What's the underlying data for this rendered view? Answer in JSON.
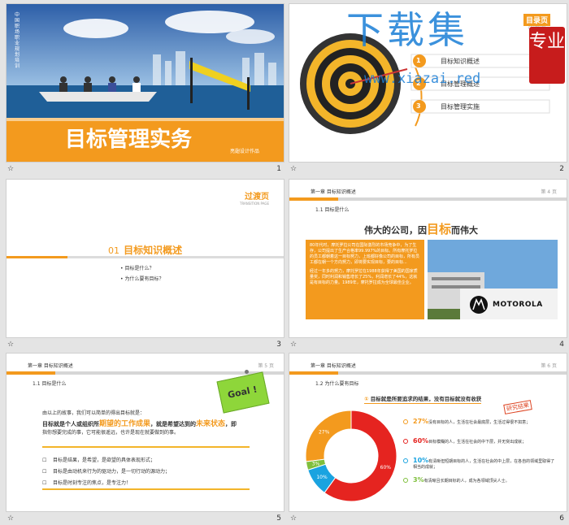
{
  "slides": {
    "s1": {
      "title": "目标管理实务",
      "vertical": "中国职场职业规划培训",
      "tag": "亮翅设计作品",
      "num": "1"
    },
    "s2": {
      "tag": "目录页",
      "tag_sub": "CONTENTS",
      "items": [
        {
          "n": "1",
          "label": "目标知识概述"
        },
        {
          "n": "2",
          "label": "目标管理概述"
        },
        {
          "n": "3",
          "label": "目标管理实施"
        }
      ],
      "num": "2",
      "watermark": "下载集",
      "watermark_url": "www.xiazai.red",
      "badge": "专业"
    },
    "s3": {
      "tag": "过渡页",
      "tag_sub": "TRANSITION PAGE",
      "sec_num": "01",
      "sec_title": "目标知识概述",
      "bullets": [
        "目标是什么？",
        "为什么要有目标？"
      ],
      "num": "3"
    },
    "s4": {
      "header": "第一章  目标知识概述",
      "page": "第 4 页",
      "sub": "1.1  目标是什么",
      "heading_a": "伟大的公司，因",
      "heading_b": "目标",
      "heading_c": "而伟大",
      "para1": "80年代时，摩托罗拉公司在国际激烈的市场竞争中，为了生存，公司提出了生产合格率99.997%的目标。所有摩托罗拉的员工都朝着这一目标努力，上班都好像公司的目标，所有员工都在朝一个方向努力，即将要实现目标，要的目标...",
      "para2": "经过一年多的努力，摩托罗拉在1988年获得了美国的国家质量奖，同时利润和销售增长了25%，利润增长了44%，这就是有目标的力量。1989年，摩托罗拉成为全球最佳企业。",
      "brand": "MOTOROLA",
      "num": "4"
    },
    "s5": {
      "header": "第一章  目标知识概述",
      "page": "第 5 页",
      "sub": "1.1  目标是什么",
      "note": "Goal !",
      "intro": "由以上的故事，我们可以简单的得出目标就是：",
      "def_a": "目标就是个人或组织所",
      "def_b": "期望的工作成果",
      "def_c": "，就是希望达到的",
      "def_d": "未来状态",
      "def_e": "，即",
      "def2": "指你想要完成的事，它可能很遥远，也许是现在就要做到的事。",
      "bullets": [
        "目标是结果，是希望，是欲望的具体表现形式；",
        "目标是由动机来行为的驱动力，是一切行动的源动力；",
        "目标是时刻专注的焦点，是专注力！"
      ],
      "num": "5"
    },
    "s6": {
      "header": "第一章  目标知识概述",
      "page": "第 6 页",
      "sub": "1.2  为什么要有目标",
      "banner_n": "①",
      "banner": "目标就是所要追求的结果，没有目标就没有收获",
      "stamp": "研究结果",
      "legend": [
        {
          "pct": "27%",
          "text": "没有目标的人，生活在社会最底层，生活过得很不如意；"
        },
        {
          "pct": "60%",
          "text": "目标模糊的人，生活在社会的中下层，并无突出成就；"
        },
        {
          "pct": "10%",
          "text": "有清晰但短期目标的人，生活在社会的中上层，在各自的领域里取得了相当的成就；"
        },
        {
          "pct": "3%",
          "text": "有清晰且长期目标的人，成为各领域顶尖人士。"
        }
      ],
      "num": "6"
    }
  },
  "chart_data": {
    "type": "pie",
    "categories": [
      "27%",
      "60%",
      "10%",
      "3%"
    ],
    "values": [
      27,
      60,
      10,
      3
    ],
    "colors": [
      "#f39a1e",
      "#e52420",
      "#1aa3e0",
      "#7fbf3c"
    ]
  },
  "footer_star": "☆"
}
